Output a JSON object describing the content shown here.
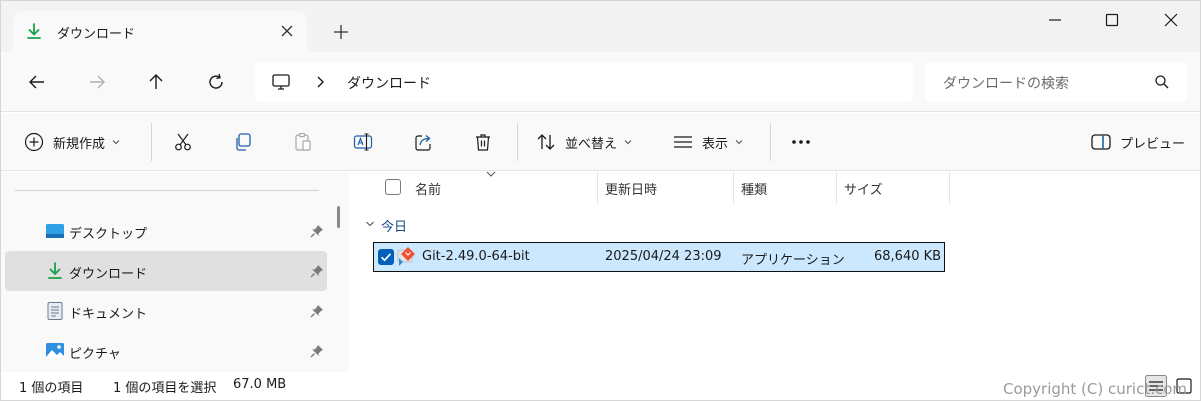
{
  "tab": {
    "title": "ダウンロード",
    "icon": "download-icon"
  },
  "address": {
    "path_segment": "ダウンロード",
    "root_icon": "computer-icon"
  },
  "search": {
    "placeholder": "ダウンロードの検索"
  },
  "commands": {
    "new_label": "新規作成",
    "sort_label": "並べ替え",
    "view_label": "表示",
    "preview_label": "プレビュー"
  },
  "nav": {
    "items": [
      {
        "label": "デスクトップ",
        "icon": "desktop-icon",
        "selected": false
      },
      {
        "label": "ダウンロード",
        "icon": "download-icon",
        "selected": true
      },
      {
        "label": "ドキュメント",
        "icon": "document-icon",
        "selected": false
      },
      {
        "label": "ピクチャ",
        "icon": "pictures-icon",
        "selected": false
      }
    ]
  },
  "columns": {
    "name": "名前",
    "modified": "更新日時",
    "type": "種類",
    "size": "サイズ"
  },
  "group": {
    "label": "今日"
  },
  "file": {
    "name": "Git-2.49.0-64-bit",
    "modified": "2025/04/24 23:09",
    "type": "アプリケーション",
    "size": "68,640 KB",
    "selected": true
  },
  "status": {
    "count": "1 個の項目",
    "selection": "1 個の項目を選択",
    "selection_size": "67.0 MB"
  },
  "watermark": "Copyright (C) curict.com",
  "colors": {
    "accent": "#005fb8",
    "selection": "#cce8ff",
    "download_green": "#16a34a"
  }
}
